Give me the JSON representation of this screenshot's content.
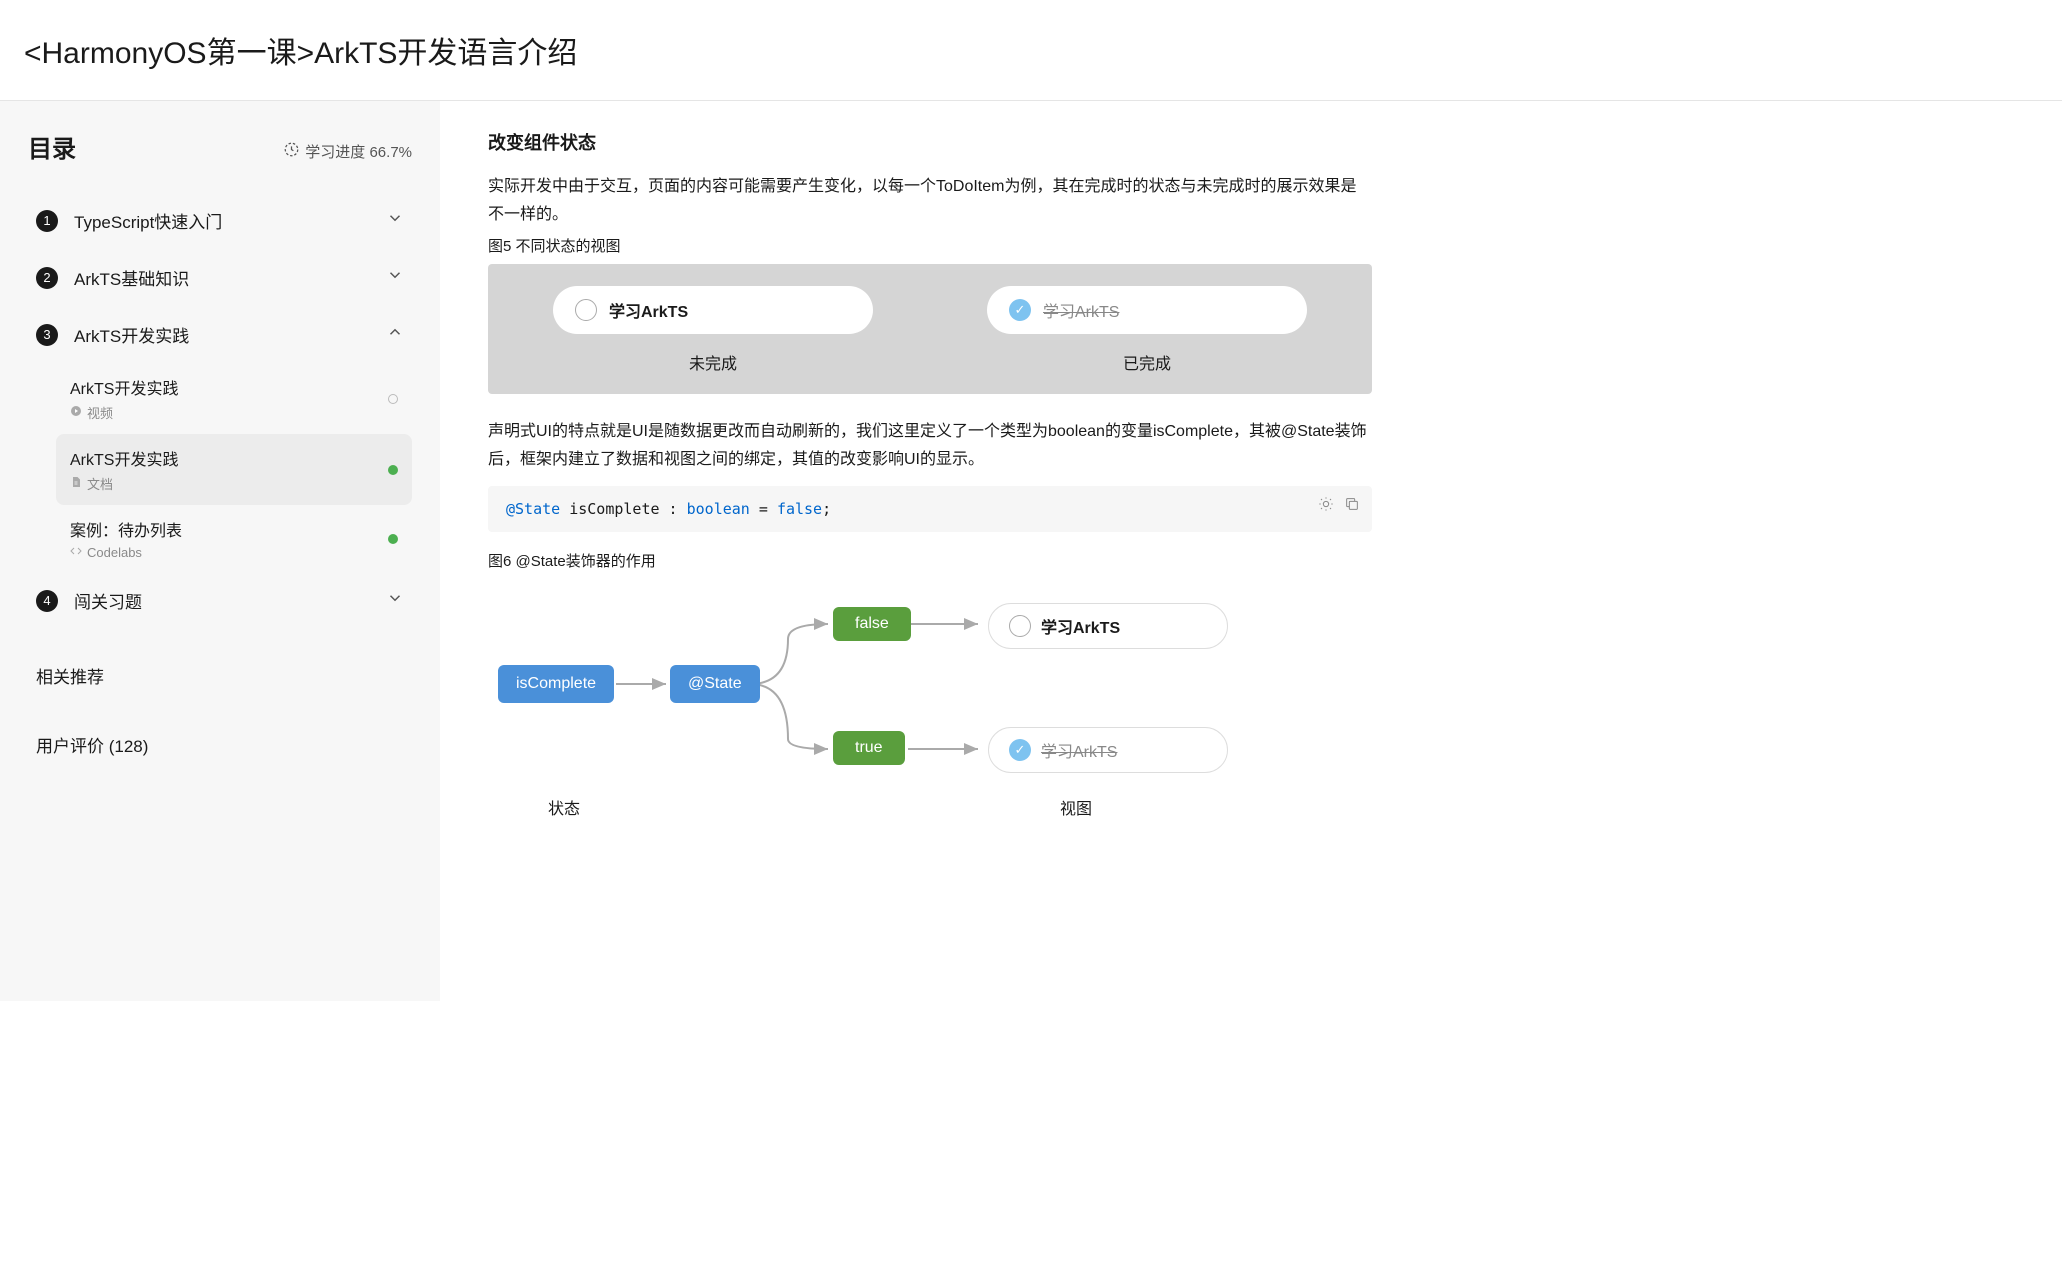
{
  "page_title": "<HarmonyOS第一课>ArkTS开发语言介绍",
  "sidebar": {
    "toc_title": "目录",
    "progress_label": "学习进度 66.7%",
    "items": [
      {
        "num": "1",
        "label": "TypeScript快速入门",
        "expanded": false
      },
      {
        "num": "2",
        "label": "ArkTS基础知识",
        "expanded": false
      },
      {
        "num": "3",
        "label": "ArkTS开发实践",
        "expanded": true
      },
      {
        "num": "4",
        "label": "闯关习题",
        "expanded": false
      }
    ],
    "sub_items": [
      {
        "title": "ArkTS开发实践",
        "type_label": "视频",
        "status": "hollow"
      },
      {
        "title": "ArkTS开发实践",
        "type_label": "文档",
        "status": "green",
        "active": true
      },
      {
        "title": "案例：待办列表",
        "type_label": "Codelabs",
        "status": "green"
      }
    ],
    "related_title": "相关推荐",
    "reviews_title": "用户评价 (128)"
  },
  "content": {
    "h2": "改变组件状态",
    "para1": "实际开发中由于交互，页面的内容可能需要产生变化，以每一个ToDoItem为例，其在完成时的状态与未完成时的展示效果是不一样的。",
    "fig5_caption": "图5 不同状态的视图",
    "fig5": {
      "incomplete_text": "学习ArkTS",
      "incomplete_label": "未完成",
      "complete_text": "学习ArkTS",
      "complete_label": "已完成"
    },
    "para2": "声明式UI的特点就是UI是随数据更改而自动刷新的，我们这里定义了一个类型为boolean的变量isComplete，其被@State装饰后，框架内建立了数据和视图之间的绑定，其值的改变影响UI的显示。",
    "code": {
      "decorator": "@State",
      "var": " isComplete : ",
      "type": "boolean",
      "rest": " = ",
      "val": "false",
      "semi": ";"
    },
    "fig6_caption": "图6 @State装饰器的作用",
    "fig6": {
      "node1": "isComplete",
      "node2": "@State",
      "node_false": "false",
      "node_true": "true",
      "view_text": "学习ArkTS",
      "axis_state": "状态",
      "axis_view": "视图"
    }
  }
}
